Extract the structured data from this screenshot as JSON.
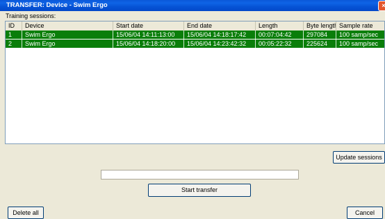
{
  "window": {
    "title": "TRANSFER: Device - Swim Ergo",
    "close_glyph": "×"
  },
  "sessions_label": "Training sessions:",
  "columns": [
    "ID",
    "Device",
    "Start date",
    "End date",
    "Length",
    "Byte length",
    "Sample rate"
  ],
  "rows": [
    {
      "id": "1",
      "device": "Swim Ergo",
      "start": "15/06/04  14:11:13:00",
      "end": "15/06/04  14:18:17:42",
      "length": "00:07:04:42",
      "bytes": "297084",
      "rate": "100 samp/sec"
    },
    {
      "id": "2",
      "device": "Swim Ergo",
      "start": "15/06/04  14:18:20:00",
      "end": "15/06/04  14:23:42:32",
      "length": "00:05:22:32",
      "bytes": "225624",
      "rate": "100 samp/sec"
    }
  ],
  "buttons": {
    "update": "Update sessions",
    "start": "Start transfer",
    "delete": "Delete all",
    "cancel": "Cancel"
  },
  "progress": {
    "value": 0
  },
  "colors": {
    "selection": "#0a7e0a",
    "titlebar": "#0654d6"
  }
}
